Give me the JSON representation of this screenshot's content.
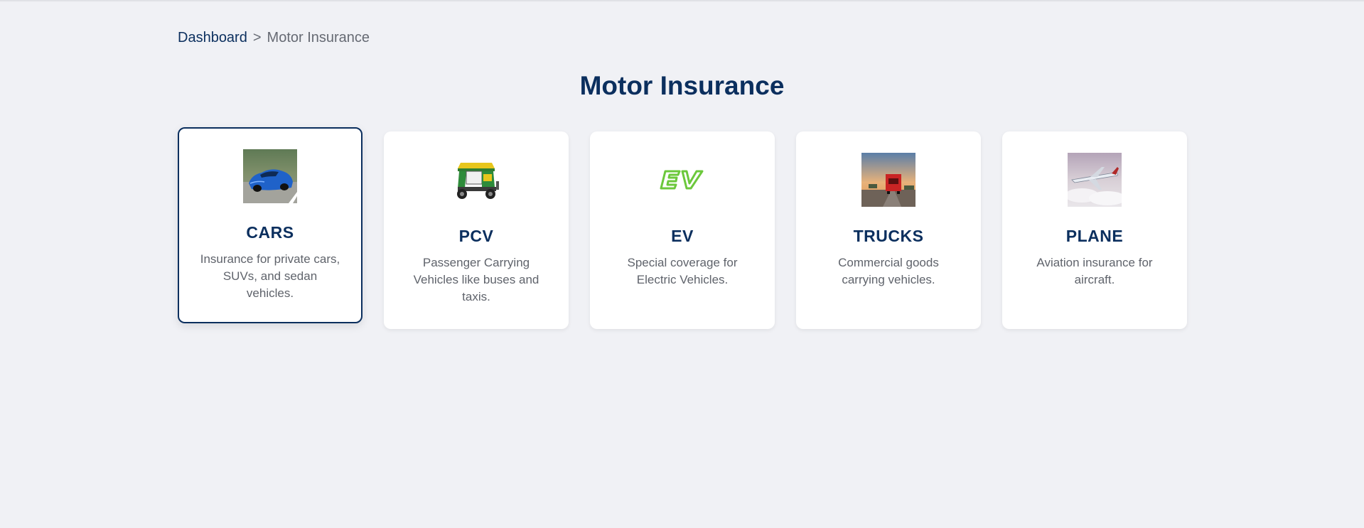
{
  "breadcrumb": {
    "home": "Dashboard",
    "separator": ">",
    "current": "Motor Insurance"
  },
  "page": {
    "title": "Motor Insurance"
  },
  "colors": {
    "primary": "#0b2f5e",
    "background": "#f0f1f5",
    "card": "#ffffff",
    "text_muted": "#5f636b"
  },
  "cards": [
    {
      "title": "CARS",
      "description": "Insurance for private cars, SUVs, and sedan vehicles.",
      "icon": "car-photo",
      "selected": true
    },
    {
      "title": "PCV",
      "description": "Passenger Carrying Vehicles like buses and taxis.",
      "icon": "auto-rickshaw-image",
      "selected": false
    },
    {
      "title": "EV",
      "description": "Special coverage for Electric Vehicles.",
      "icon": "ev-logo",
      "selected": false
    },
    {
      "title": "TRUCKS",
      "description": "Commercial goods carrying vehicles.",
      "icon": "truck-photo",
      "selected": false
    },
    {
      "title": "PLANE",
      "description": "Aviation insurance for aircraft.",
      "icon": "plane-photo",
      "selected": false
    }
  ]
}
